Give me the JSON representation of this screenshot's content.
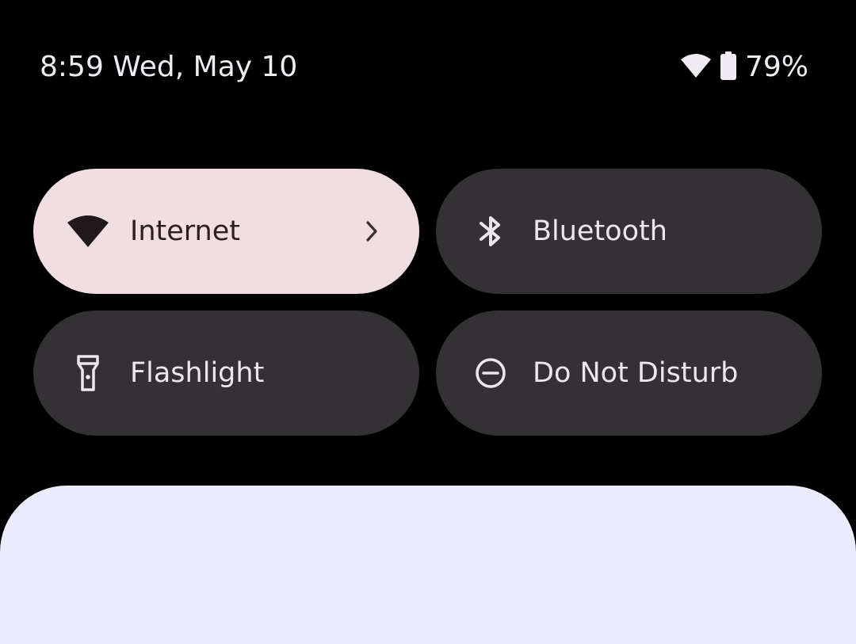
{
  "status_bar": {
    "time_date": "8:59 Wed, May 10",
    "battery_percent": "79%",
    "wifi_icon": "wifi-icon",
    "battery_icon": "battery-icon"
  },
  "quick_settings": {
    "tiles": [
      {
        "label": "Internet",
        "icon": "wifi-icon",
        "state": "on",
        "has_chevron": true
      },
      {
        "label": "Bluetooth",
        "icon": "bluetooth-icon",
        "state": "off"
      },
      {
        "label": "Flashlight",
        "icon": "flashlight-icon",
        "state": "off"
      },
      {
        "label": "Do Not Disturb",
        "icon": "do-not-disturb-icon",
        "state": "off"
      }
    ]
  },
  "colors": {
    "background": "#000000",
    "tile_active": "#F2DEE1",
    "tile_inactive": "#343135",
    "bottom_panel": "#EBEDFE"
  }
}
